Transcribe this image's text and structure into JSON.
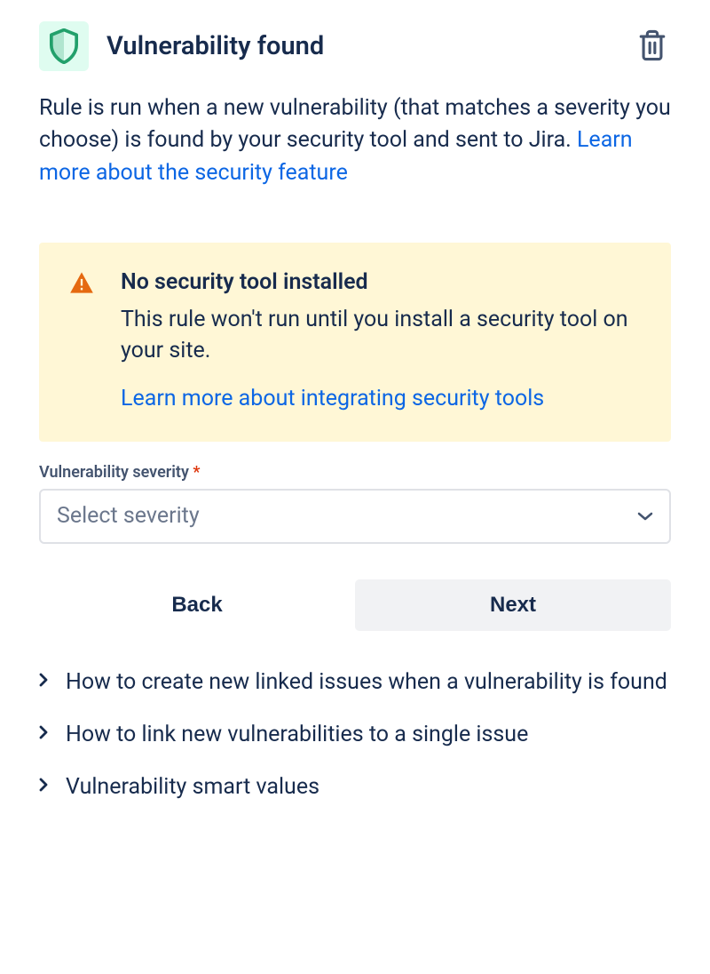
{
  "header": {
    "title": "Vulnerability found"
  },
  "description": {
    "text": "Rule is run when a new vulnerability (that matches a severity you choose) is found by your security tool and sent to Jira. ",
    "link": "Learn more about the security feature"
  },
  "warning": {
    "title": "No security tool installed",
    "text": "This rule won't run until you install a security tool on your site.",
    "link": "Learn more about integrating security tools"
  },
  "field": {
    "label": "Vulnerability severity",
    "required_marker": "*",
    "placeholder": "Select severity"
  },
  "buttons": {
    "back": "Back",
    "next": "Next"
  },
  "help_items": [
    "How to create new linked issues when a vulnerability is found",
    "How to link new vulnerabilities to a single issue",
    "Vulnerability smart values"
  ]
}
